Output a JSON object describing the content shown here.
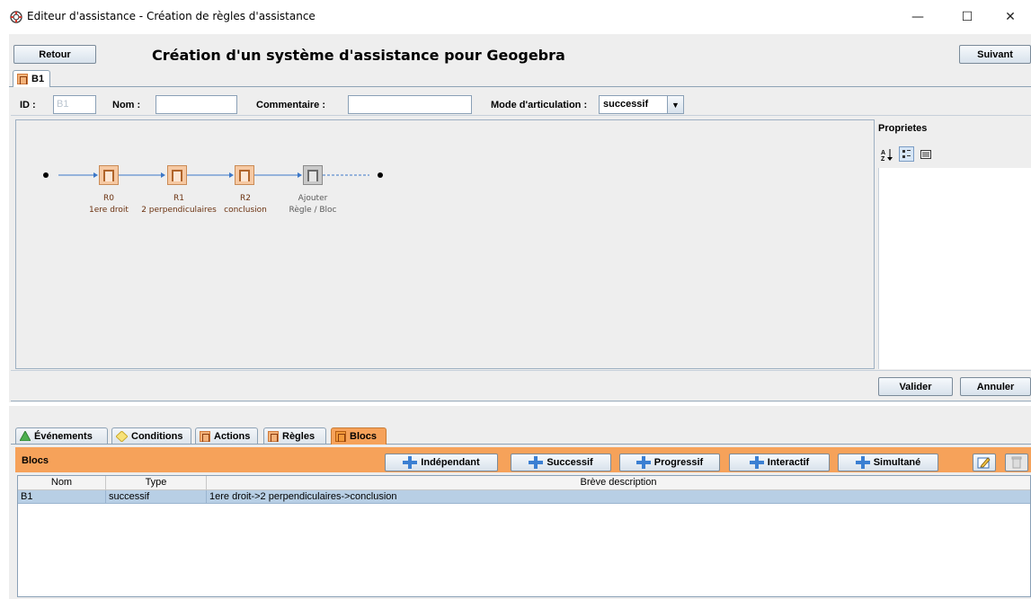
{
  "window": {
    "title": "Editeur d'assistance - Création de règles d'assistance",
    "minimize": "—",
    "maximize": "☐",
    "close": "✕"
  },
  "toolbar": {
    "back_label": "Retour",
    "heading": "Création d'un système d'assistance pour Geogebra",
    "next_label": "Suivant"
  },
  "top_tab": {
    "label": "B1"
  },
  "form": {
    "id_label": "ID :",
    "id_value": "B1",
    "name_label": "Nom :",
    "name_value": "",
    "comment_label": "Commentaire :",
    "comment_value": "",
    "mode_label": "Mode d'articulation :",
    "mode_value": "successif"
  },
  "diagram": {
    "nodes": [
      {
        "id": "R0",
        "desc": "1ere droit"
      },
      {
        "id": "R1",
        "desc": "2 perpendiculaires"
      },
      {
        "id": "R2",
        "desc": "conclusion"
      },
      {
        "id": "Ajouter",
        "desc": "Règle / Bloc"
      }
    ]
  },
  "properties": {
    "title": "Proprietes",
    "sort_icon": "sort-az-icon",
    "categorized_icon": "categorized-icon",
    "list_icon": "list-icon"
  },
  "dialog_buttons": {
    "validate": "Valider",
    "cancel": "Annuler"
  },
  "bottom_tabs": [
    {
      "label": "Événements",
      "icon": "triangle-icon"
    },
    {
      "label": "Conditions",
      "icon": "diamond-icon"
    },
    {
      "label": "Actions",
      "icon": "rule-icon"
    },
    {
      "label": "Règles",
      "icon": "rule-icon"
    },
    {
      "label": "Blocs",
      "icon": "rule-icon"
    }
  ],
  "blocs": {
    "title": "Blocs",
    "buttons": [
      "Indépendant",
      "Successif",
      "Progressif",
      "Interactif",
      "Simultané"
    ],
    "columns": [
      "Nom",
      "Type",
      "Brève description"
    ],
    "rows": [
      {
        "name": "B1",
        "type": "successif",
        "description": "1ere droit->2 perpendiculaires->conclusion"
      }
    ]
  },
  "colors": {
    "accent_orange": "#f6a25a",
    "selection_blue": "#b8cfe5",
    "plus_blue": "#3b7fd2"
  }
}
